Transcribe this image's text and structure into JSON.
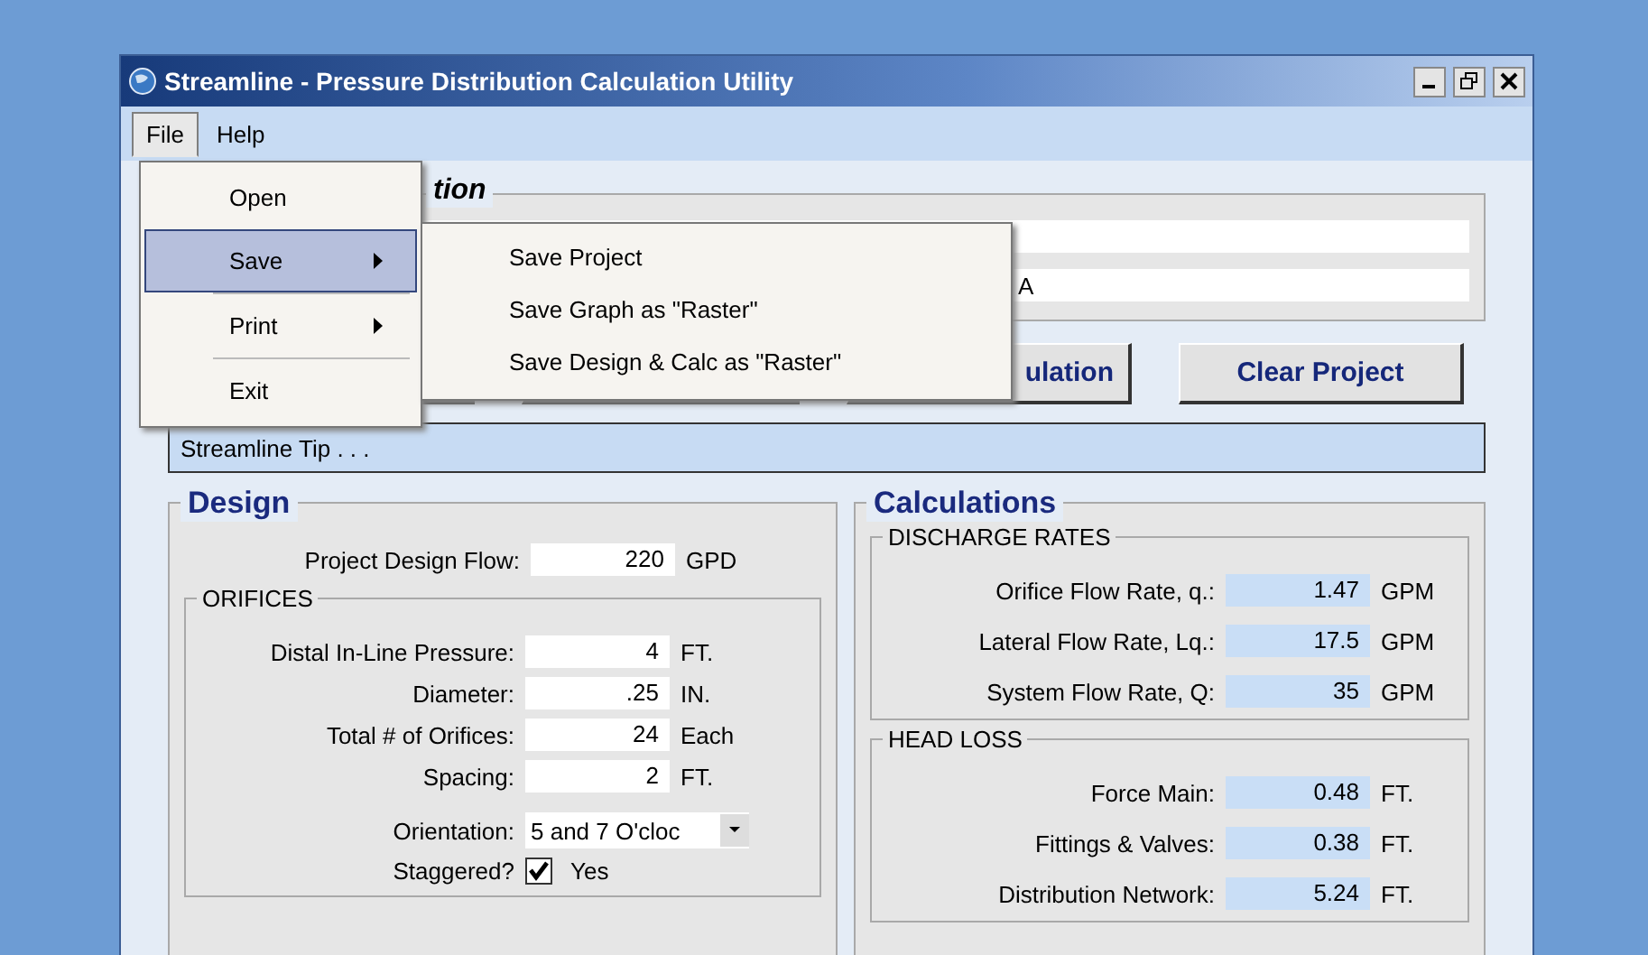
{
  "window": {
    "title": "Streamline - Pressure Distribution Calculation Utility"
  },
  "menu_bar": [
    {
      "label": "File",
      "selected": true
    },
    {
      "label": "Help",
      "selected": false
    }
  ],
  "file_menu": [
    {
      "label": "Open",
      "submenu": false,
      "selected": false,
      "separator_before": false
    },
    {
      "label": "Save",
      "submenu": true,
      "selected": true,
      "separator_before": false
    },
    {
      "label": "Print",
      "submenu": true,
      "selected": false,
      "separator_before": true
    },
    {
      "label": "Exit",
      "submenu": false,
      "selected": false,
      "separator_before": true
    }
  ],
  "save_submenu": [
    "Save Project",
    "Save Graph as \"Raster\"",
    "Save Design & Calc as \"Raster\""
  ],
  "project_info": {
    "title": "tion",
    "field_2": {
      "value": "A"
    }
  },
  "buttons": [
    {
      "kind": "blank"
    },
    {
      "kind": "blank"
    },
    {
      "kind": "partial",
      "label": "ulation"
    },
    {
      "kind": "text",
      "label": "Clear Project"
    }
  ],
  "tip": "Streamline Tip . . .",
  "design": {
    "title": "Design",
    "flow": {
      "label": "Project Design Flow:",
      "value": "220",
      "unit": "GPD"
    },
    "orifices": {
      "title": "ORIFICES",
      "rows": [
        {
          "label": "Distal In-Line Pressure:",
          "value": "4",
          "unit": "FT."
        },
        {
          "label": "Diameter:",
          "value": ".25",
          "unit": "IN."
        },
        {
          "label": "Total # of Orifices:",
          "value": "24",
          "unit": "Each"
        },
        {
          "label": "Spacing:",
          "value": "2",
          "unit": "FT."
        }
      ],
      "orientation": {
        "label": "Orientation:",
        "value": "5 and 7 O'cloc"
      },
      "staggered": {
        "label": "Staggered?",
        "checked": true,
        "text": "Yes"
      }
    }
  },
  "calculations": {
    "title": "Calculations",
    "groups": [
      {
        "title": "DISCHARGE RATES",
        "rows": [
          {
            "label": "Orifice Flow Rate, q.:",
            "value": "1.47",
            "unit": "GPM"
          },
          {
            "label": "Lateral Flow Rate, Lq.:",
            "value": "17.5",
            "unit": "GPM"
          },
          {
            "label": "System Flow Rate, Q:",
            "value": "35",
            "unit": "GPM"
          }
        ]
      },
      {
        "title": "HEAD LOSS",
        "rows": [
          {
            "label": "Force Main:",
            "value": "0.48",
            "unit": "FT."
          },
          {
            "label": "Fittings & Valves:",
            "value": "0.38",
            "unit": "FT."
          },
          {
            "label": "Distribution Network:",
            "value": "5.24",
            "unit": "FT."
          }
        ]
      }
    ]
  }
}
